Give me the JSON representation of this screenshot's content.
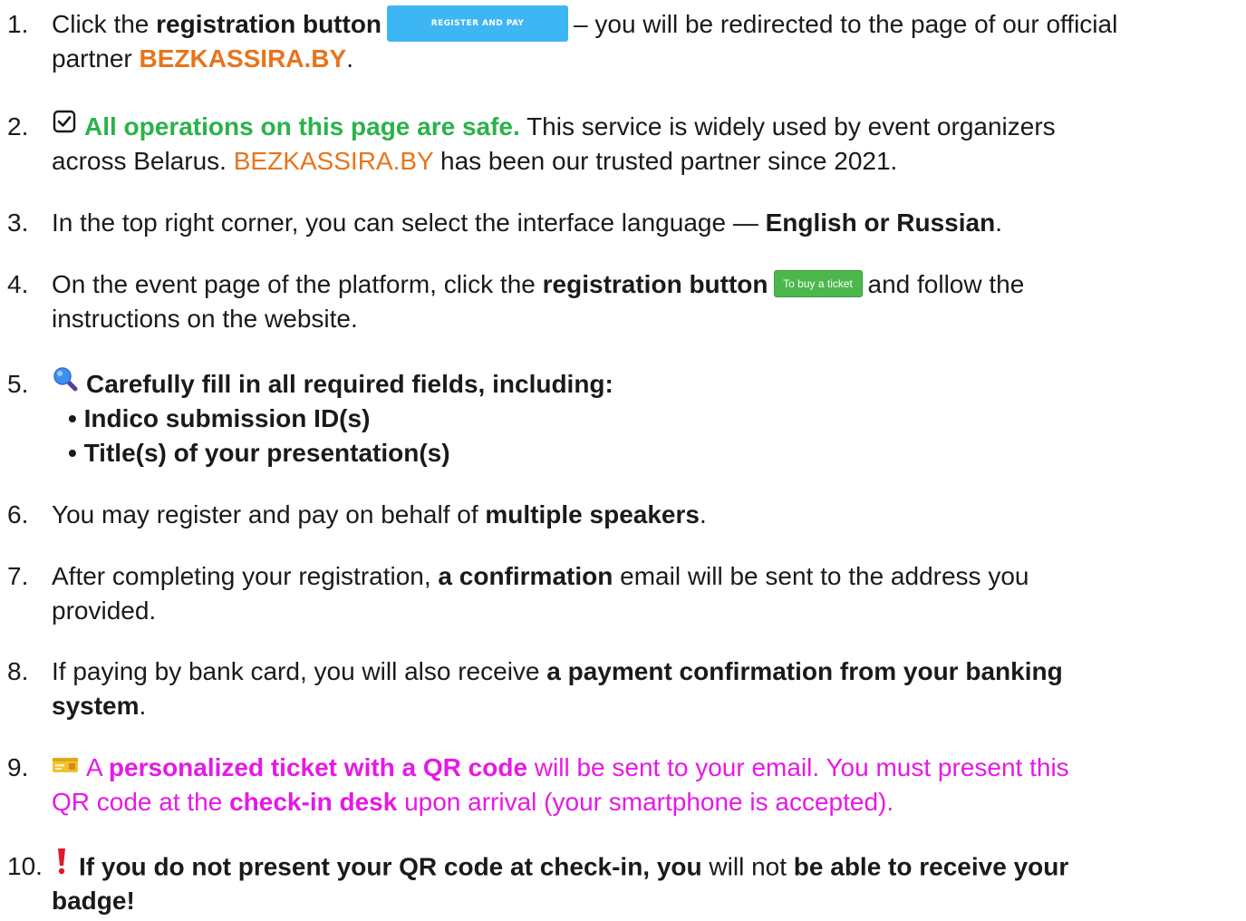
{
  "items": [
    {
      "number": "1.",
      "l1_t1": "Click the ",
      "l1_t2": "registration button",
      "l1_button": "REGISTER AND PAY",
      "l1_t3": "– you will be redirected to the page of our official",
      "l2_t1": "partner ",
      "l2_t2": "BEZKASSIRA.BY",
      "l2_t3": "."
    },
    {
      "number": "2.",
      "icon": "checkbox-checked-icon",
      "l1_t1": "All operations on this page are safe.",
      "l1_t2": " This service is widely used by event organizers",
      "l2_t1": "across Belarus. ",
      "l2_t2": "BEZKASSIRA.BY",
      "l2_t3": " has been our trusted partner since 2021."
    },
    {
      "number": "3.",
      "l1_t1": "In the top right corner, you can select the interface language — ",
      "l1_t2": "English or Russian",
      "l1_t3": "."
    },
    {
      "number": "4.",
      "l1_t1": "On the event page of the platform, click the ",
      "l1_t2": "registration button",
      "l1_button": "To buy a ticket",
      "l1_t3": "and follow the",
      "l2_t1": "instructions on the website."
    },
    {
      "number": "5.",
      "icon": "magnifier-icon",
      "l1_t1": "Carefully fill in all required fields, including:",
      "l2_t1": "• Indico submission ID(s)",
      "l3_t1": "• Title(s) of your presentation(s)"
    },
    {
      "number": "6.",
      "l1_t1": "You may register and pay on behalf of ",
      "l1_t2": "multiple speakers",
      "l1_t3": "."
    },
    {
      "number": "7.",
      "l1_t1": "After completing your registration, ",
      "l1_t2": "a confirmation",
      "l1_t3": " email will be sent to the address you",
      "l2_t1": "provided."
    },
    {
      "number": "8.",
      "l1_t1": "If paying by bank card, you will also receive ",
      "l1_t2": "a payment confirmation from your banking",
      "l2_t1": "system",
      "l2_t2": "."
    },
    {
      "number": "9.",
      "icon": "ticket-icon",
      "l1_t1": "A ",
      "l1_t2": "personalized ticket with a QR code",
      "l1_t3": " will be sent to your email. You must present this",
      "l2_t1": "QR code at the ",
      "l2_t2": "check-in desk",
      "l2_t3": " upon arrival (your smartphone is accepted)."
    },
    {
      "number": "10.",
      "icon": "exclamation-icon",
      "l1_t1": "If you do not present your QR code at check-in, you",
      "l1_t2": " will not ",
      "l1_t3": "be able to receive your",
      "l2_t1": "badge!"
    }
  ],
  "colors": {
    "orange": "#e8741c",
    "green": "#29b34a",
    "magenta": "#e619e6",
    "register_button": "#3fb6f4",
    "buy_button": "#4cb84c",
    "exclamation": "#e0182d"
  }
}
